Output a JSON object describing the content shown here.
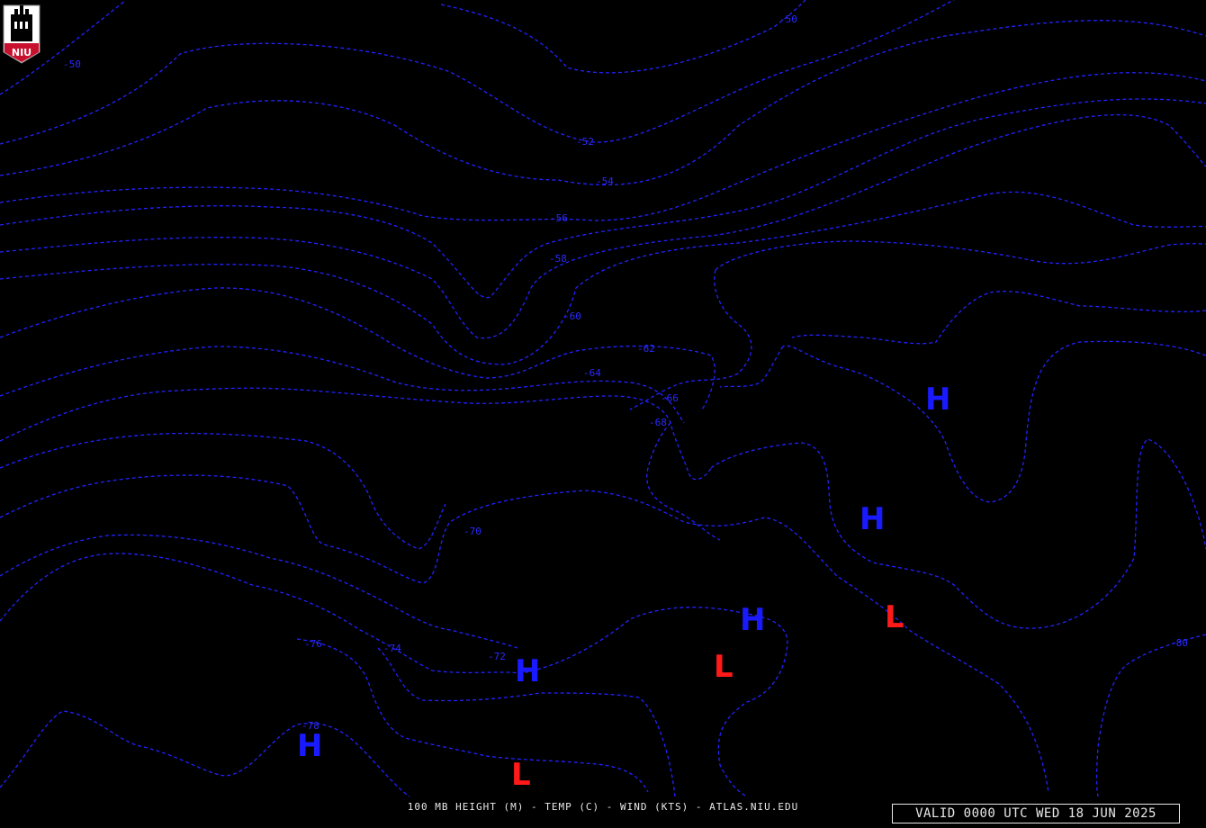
{
  "logo": {
    "text": "NIU",
    "colors": {
      "shield": "#ffffff",
      "banner": "#c8102e"
    }
  },
  "footer": {
    "caption": "100 MB HEIGHT (M) - TEMP (C) - WIND (KTS) - ATLAS.NIU.EDU",
    "valid_time": "VALID 0000 UTC WED 18 JUN 2025"
  },
  "colors": {
    "isotherm": "#2222ff",
    "high_marker": "#1a1aff",
    "low_marker": "#ff1a1a",
    "background": "#000000"
  },
  "isotherm_labels": [
    "-50",
    "-50",
    "-52",
    "-54",
    "-56",
    "-58",
    "-60",
    "-62",
    "-64",
    "-66",
    "-68",
    "-70",
    "-72",
    "-74",
    "-76",
    "-78",
    "-80"
  ],
  "pressure_centers": {
    "high_symbol": "H",
    "low_symbol": "L",
    "highs_count": 5,
    "lows_count": 3
  }
}
